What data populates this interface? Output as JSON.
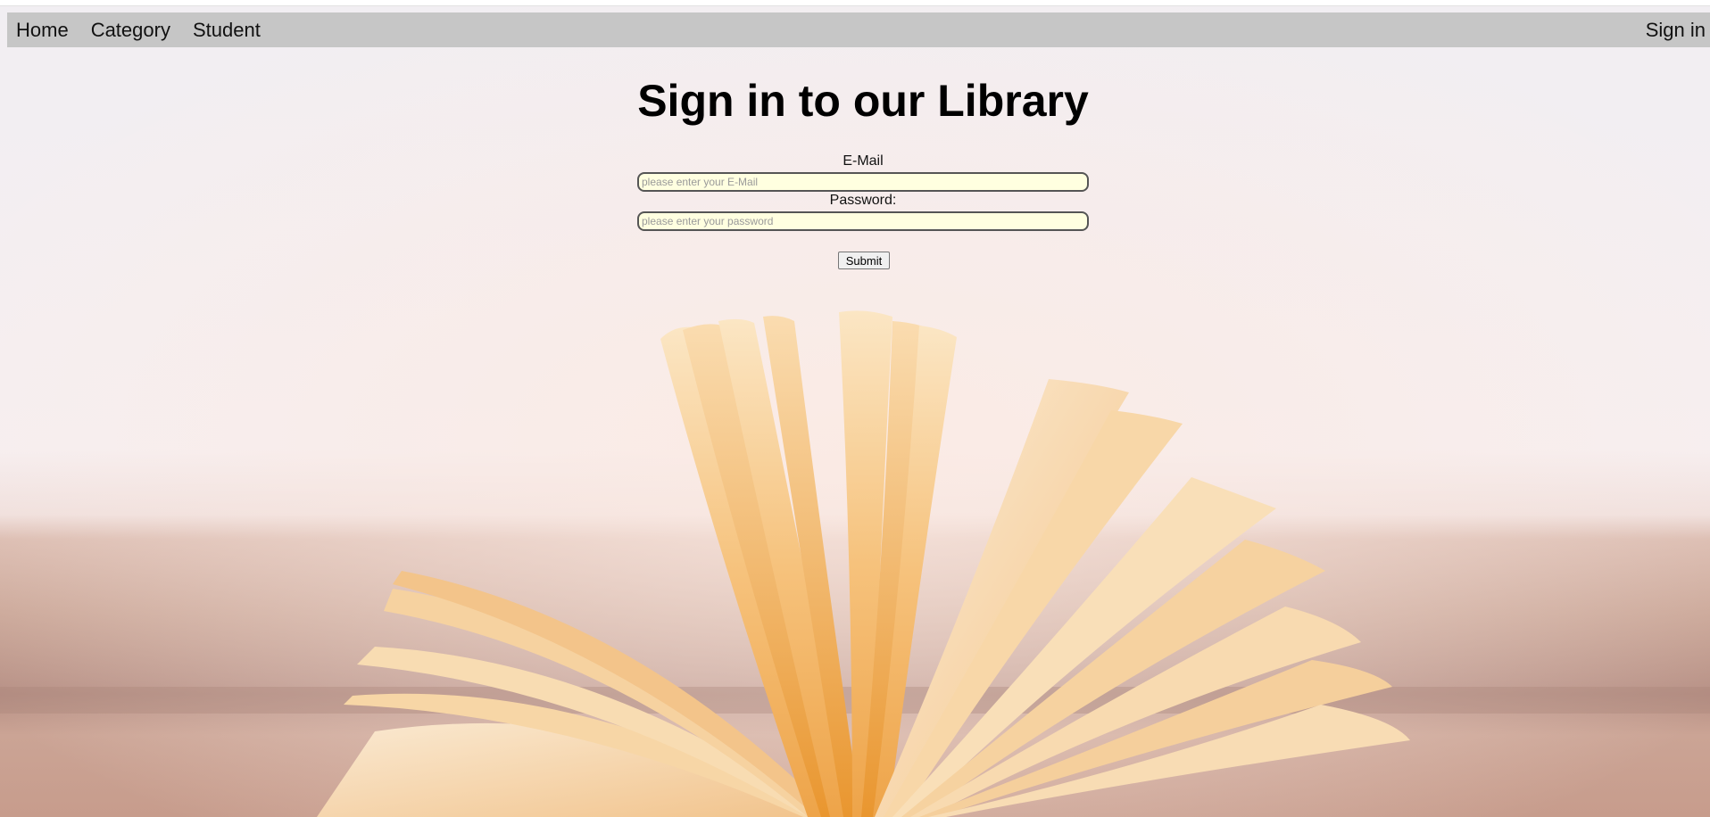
{
  "nav": {
    "left_items": [
      "Home",
      "Category",
      "Student"
    ],
    "right_item": "Sign in",
    "background_color": "#c6c6c6"
  },
  "main": {
    "title": "Sign in to our Library",
    "email": {
      "label": "E-Mail",
      "placeholder": "please enter your E-Mail",
      "value": ""
    },
    "password": {
      "label": "Password:",
      "placeholder": "please enter your password",
      "value": ""
    },
    "submit_label": "Submit",
    "input_background_color": "#ffffe0"
  },
  "background": {
    "image_subject": "open-book-on-wooden-table",
    "colors": {
      "wall": "#f3eef0",
      "table": "#c9a596",
      "pages": "#f4b869"
    }
  }
}
